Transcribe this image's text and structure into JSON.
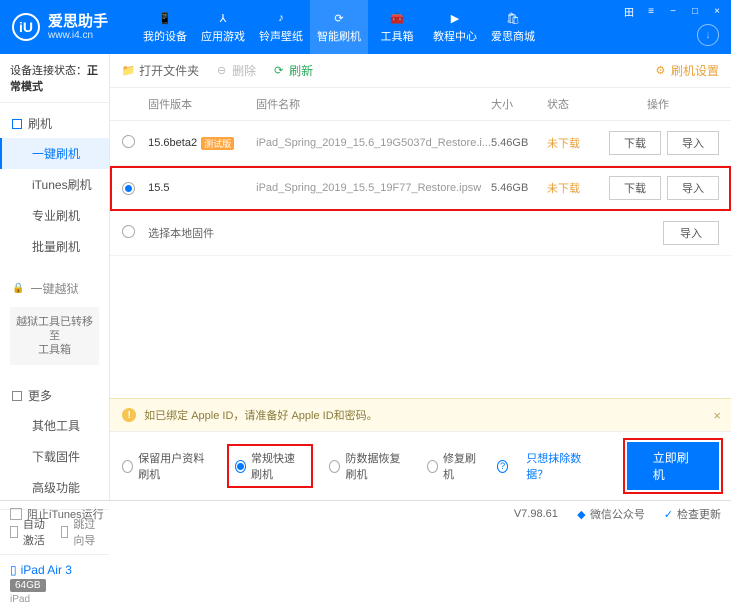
{
  "brand": {
    "name": "爱思助手",
    "sub": "www.i4.cn",
    "logo_letter": "iU"
  },
  "nav": [
    {
      "label": "我的设备"
    },
    {
      "label": "应用游戏"
    },
    {
      "label": "铃声壁纸"
    },
    {
      "label": "智能刷机"
    },
    {
      "label": "工具箱"
    },
    {
      "label": "教程中心"
    },
    {
      "label": "爱思商城"
    }
  ],
  "nav_active_index": 3,
  "titleicons": [
    "田",
    "≡",
    "−",
    "□",
    "×"
  ],
  "sidebar": {
    "status_label": "设备连接状态：",
    "status_value": "正常模式",
    "grp_flash": "刷机",
    "items_flash": [
      "一键刷机",
      "iTunes刷机",
      "专业刷机",
      "批量刷机"
    ],
    "active_flash_index": 0,
    "grp_jail": "一键越狱",
    "jail_msg": "越狱工具已转移至\n工具箱",
    "grp_more": "更多",
    "items_more": [
      "其他工具",
      "下载固件",
      "高级功能"
    ],
    "chk_auto": "自动激活",
    "chk_skip": "跳过向导",
    "device": {
      "name": "iPad Air 3",
      "storage": "64GB",
      "type": "iPad"
    }
  },
  "toolbar": {
    "open": "打开文件夹",
    "delete": "删除",
    "refresh": "刷新",
    "settings": "刷机设置"
  },
  "table": {
    "h_ver": "固件版本",
    "h_name": "固件名称",
    "h_size": "大小",
    "h_stat": "状态",
    "h_act": "操作",
    "rows": [
      {
        "ver": "15.6beta2",
        "tag": "测试版",
        "name": "iPad_Spring_2019_15.6_19G5037d_Restore.i...",
        "size": "5.46GB",
        "stat": "未下载",
        "dl": "下载",
        "imp": "导入",
        "checked": false
      },
      {
        "ver": "15.5",
        "tag": "",
        "name": "iPad_Spring_2019_15.5_19F77_Restore.ipsw",
        "size": "5.46GB",
        "stat": "未下载",
        "dl": "下载",
        "imp": "导入",
        "checked": true
      }
    ],
    "local_label": "选择本地固件",
    "local_import": "导入"
  },
  "alert": "如已绑定 Apple ID，请准备好 Apple ID和密码。",
  "options": {
    "o1": "保留用户资料刷机",
    "o2": "常规快速刷机",
    "o3": "防数据恢复刷机",
    "o4": "修复刷机",
    "link": "只想抹除数据？",
    "primary": "立即刷机",
    "selected": 1
  },
  "statusbar": {
    "block": "阻止iTunes运行",
    "version": "V7.98.61",
    "wechat": "微信公众号",
    "update": "检查更新"
  }
}
